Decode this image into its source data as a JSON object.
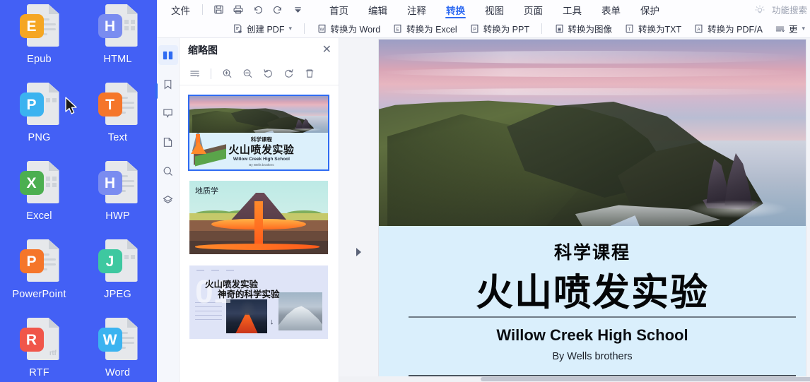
{
  "desktop": {
    "files": [
      {
        "label": "Epub",
        "badge": "E",
        "color": "#f5a623",
        "art": "lines"
      },
      {
        "label": "HTML",
        "badge": "H",
        "color": "#7a8cf0",
        "art": "code"
      },
      {
        "label": "PNG",
        "badge": "P",
        "color": "#3bb3f0",
        "art": "image"
      },
      {
        "label": "Text",
        "badge": "T",
        "color": "#f5762a",
        "art": "lines"
      },
      {
        "label": "Excel",
        "badge": "X",
        "color": "#4caf50",
        "art": "grid"
      },
      {
        "label": "HWP",
        "badge": "H",
        "color": "#7a8cf0",
        "art": "lines"
      },
      {
        "label": "PowerPoint",
        "badge": "P",
        "color": "#f5762a",
        "art": "chart"
      },
      {
        "label": "JPEG",
        "badge": "J",
        "color": "#3ec8a0",
        "art": "image"
      },
      {
        "label": "RTF",
        "badge": "R",
        "color": "#f0564a",
        "art": "rtf"
      },
      {
        "label": "Word",
        "badge": "W",
        "color": "#3bb3f0",
        "art": "lines"
      }
    ],
    "cursor_icon": "mouse-pointer-icon",
    "background_color": "#4360f5"
  },
  "ribbon": {
    "file_menu": "文件",
    "quick_access": [
      {
        "name": "save-icon",
        "title": "保存"
      },
      {
        "name": "print-icon",
        "title": "打印"
      },
      {
        "name": "undo-icon",
        "title": "撤销"
      },
      {
        "name": "redo-icon",
        "title": "重做"
      },
      {
        "name": "more-arrow-icon",
        "title": "更多"
      }
    ],
    "tabs": [
      {
        "label": "首页",
        "active": false
      },
      {
        "label": "编辑",
        "active": false
      },
      {
        "label": "注释",
        "active": false
      },
      {
        "label": "转换",
        "active": true
      },
      {
        "label": "视图",
        "active": false
      },
      {
        "label": "页面",
        "active": false
      },
      {
        "label": "工具",
        "active": false
      },
      {
        "label": "表单",
        "active": false
      },
      {
        "label": "保护",
        "active": false
      }
    ],
    "feature_search": {
      "icon": "lightbulb-icon",
      "label": "功能搜索"
    },
    "tools": [
      {
        "label": "创建 PDF",
        "icon": "create-pdf-icon",
        "glyph": "F",
        "caret": true
      },
      {
        "label": "转换为 Word",
        "icon": "convert-to-word-icon",
        "glyph": "W",
        "caret": false
      },
      {
        "label": "转换为 Excel",
        "icon": "convert-to-excel-icon",
        "glyph": "E",
        "caret": false
      },
      {
        "label": "转换为 PPT",
        "icon": "convert-to-ppt-icon",
        "glyph": "P",
        "caret": false
      },
      {
        "label": "转换为图像",
        "icon": "convert-to-image-icon",
        "glyph": "▣",
        "caret": false
      },
      {
        "label": "转换为TXT",
        "icon": "convert-to-txt-icon",
        "glyph": "T",
        "caret": false
      },
      {
        "label": "转换为 PDF/A",
        "icon": "convert-to-pdfa-icon",
        "glyph": "A",
        "caret": false
      },
      {
        "label": "更",
        "icon": "more-options-icon",
        "glyph": "",
        "caret": true
      }
    ],
    "accent_color": "#2f6bf2"
  },
  "rail": {
    "items": [
      {
        "name": "sidebar-item-thumbnails",
        "icon": "thumbnails-icon",
        "active": true
      },
      {
        "name": "sidebar-item-bookmarks",
        "icon": "bookmark-icon",
        "active": false
      },
      {
        "name": "sidebar-item-comments",
        "icon": "comment-icon",
        "active": false
      },
      {
        "name": "sidebar-item-attachments",
        "icon": "page-icon",
        "active": false
      },
      {
        "name": "sidebar-item-search",
        "icon": "search-icon",
        "active": false
      },
      {
        "name": "sidebar-item-layers",
        "icon": "layers-icon",
        "active": false
      }
    ]
  },
  "thumbnail_panel": {
    "title": "缩略图",
    "close_icon": "close-icon",
    "tools": [
      {
        "name": "list-options-icon",
        "icon": "list-options-icon"
      },
      {
        "name": "zoom-in-icon",
        "icon": "zoom-in-icon"
      },
      {
        "name": "zoom-out-icon",
        "icon": "zoom-out-icon"
      },
      {
        "name": "rotate-left-icon",
        "icon": "rotate-left-icon"
      },
      {
        "name": "rotate-right-icon",
        "icon": "rotate-right-icon"
      },
      {
        "name": "delete-icon",
        "icon": "trash-icon"
      }
    ],
    "collapse_icon": "collapse-panel-icon",
    "slides": [
      {
        "index": 1,
        "selected": true,
        "kind": "title-slide",
        "cn_small": "科学课程",
        "cn_big": "火山喷发实验",
        "en_title": "Willow Creek High School",
        "en_sub": "By Wells brothers"
      },
      {
        "index": 2,
        "selected": false,
        "kind": "volcano-cross-section",
        "label": "地质学"
      },
      {
        "index": 3,
        "selected": false,
        "kind": "photo-collage",
        "title_line1": "火山喷发实验",
        "title_line2": "神奇的科学实验",
        "ghost_number": "01",
        "arrow_icon": "arrow-down-icon"
      }
    ]
  },
  "viewer": {
    "page": {
      "cn_small": "科学课程",
      "cn_big": "火山喷发实验",
      "en_title": "Willow Creek High School",
      "en_sub": "By Wells brothers",
      "photo_alt": "coastal-cliff-sunset-photo",
      "background_color": "#daeffc"
    },
    "horizontal_scrollbar": "page-hscrollbar"
  }
}
